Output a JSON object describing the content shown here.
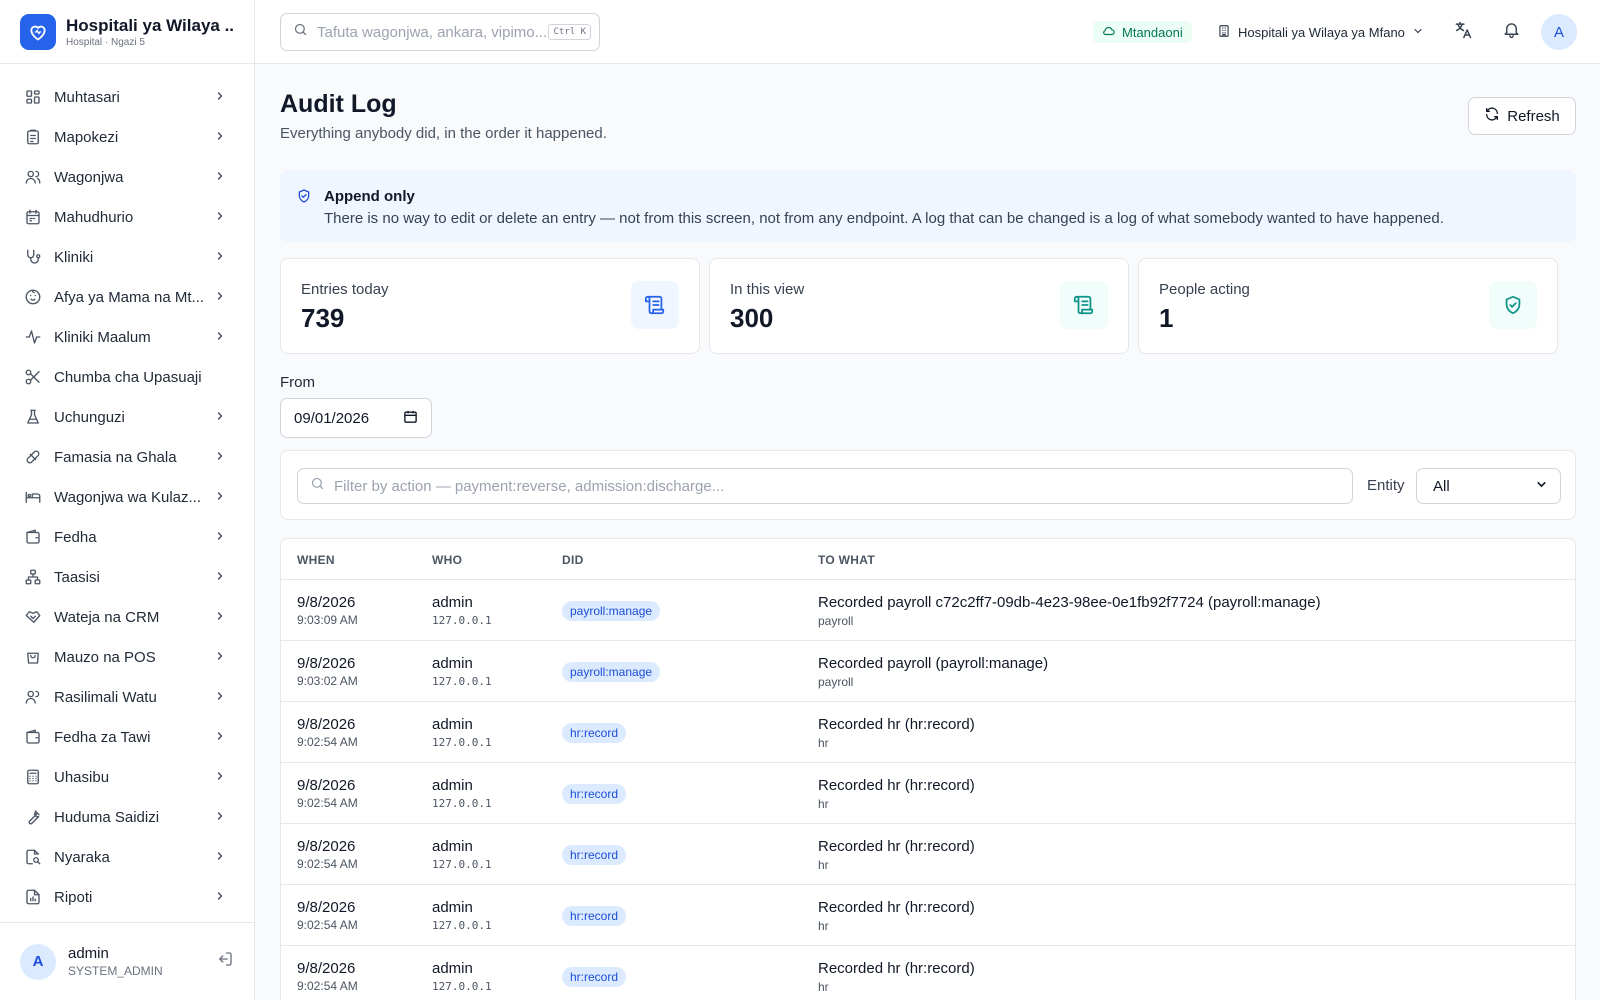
{
  "brand": {
    "name": "Hospitali ya Wilaya ...",
    "subtitle": "Hospital · Ngazi 5"
  },
  "sidebar": {
    "items": [
      {
        "label": "Muhtasari",
        "icon": "dashboard-icon",
        "chevron": true
      },
      {
        "label": "Mapokezi",
        "icon": "clipboard-icon",
        "chevron": true
      },
      {
        "label": "Wagonjwa",
        "icon": "users-icon",
        "chevron": true
      },
      {
        "label": "Mahudhurio",
        "icon": "calendar-icon",
        "chevron": true
      },
      {
        "label": "Kliniki",
        "icon": "stethoscope-icon",
        "chevron": true
      },
      {
        "label": "Afya ya Mama na Mt...",
        "icon": "baby-icon",
        "chevron": true
      },
      {
        "label": "Kliniki Maalum",
        "icon": "activity-icon",
        "chevron": true
      },
      {
        "label": "Chumba cha Upasuaji",
        "icon": "scissors-icon",
        "chevron": false
      },
      {
        "label": "Uchunguzi",
        "icon": "flask-icon",
        "chevron": true
      },
      {
        "label": "Famasia na Ghala",
        "icon": "pill-icon",
        "chevron": true
      },
      {
        "label": "Wagonjwa wa Kulaz...",
        "icon": "bed-icon",
        "chevron": true
      },
      {
        "label": "Fedha",
        "icon": "wallet-icon",
        "chevron": true
      },
      {
        "label": "Taasisi",
        "icon": "org-chart-icon",
        "chevron": true
      },
      {
        "label": "Wateja na CRM",
        "icon": "handshake-icon",
        "chevron": true
      },
      {
        "label": "Mauzo na POS",
        "icon": "shopping-bag-icon",
        "chevron": true
      },
      {
        "label": "Rasilimali Watu",
        "icon": "user-group-icon",
        "chevron": true
      },
      {
        "label": "Fedha za Tawi",
        "icon": "wallet-branch-icon",
        "chevron": true
      },
      {
        "label": "Uhasibu",
        "icon": "calculator-icon",
        "chevron": true
      },
      {
        "label": "Huduma Saidizi",
        "icon": "wrench-icon",
        "chevron": true
      },
      {
        "label": "Nyaraka",
        "icon": "file-search-icon",
        "chevron": true
      },
      {
        "label": "Ripoti",
        "icon": "report-icon",
        "chevron": true
      }
    ]
  },
  "user": {
    "initial": "A",
    "name": "admin",
    "role": "SYSTEM_ADMIN"
  },
  "topbar": {
    "search_placeholder": "Tafuta wagonjwa, ankara, vipimo...",
    "shortcut": "Ctrl K",
    "status": "Mtandaoni",
    "facility": "Hospitali ya Wilaya ya Mfano",
    "avatar_initial": "A"
  },
  "page": {
    "title": "Audit Log",
    "subtitle": "Everything anybody did, in the order it happened.",
    "refresh_label": "Refresh"
  },
  "notice": {
    "title": "Append only",
    "text": "There is no way to edit or delete an entry — not from this screen, not from any endpoint. A log that can be changed is a log of what somebody wanted to have happened."
  },
  "stats": [
    {
      "label": "Entries today",
      "value": "739",
      "icon": "scroll-icon",
      "color": "#2563eb",
      "bg": "#eff6ff"
    },
    {
      "label": "In this view",
      "value": "300",
      "icon": "scroll-icon",
      "color": "#0d9488",
      "bg": "#f0fdfa"
    },
    {
      "label": "People acting",
      "value": "1",
      "icon": "shield-check-icon",
      "color": "#0d9488",
      "bg": "#f0fdfa"
    }
  ],
  "filters": {
    "from_label": "From",
    "from_value": "09/01/2026",
    "action_placeholder": "Filter by action — payment:reverse, admission:discharge...",
    "entity_label": "Entity",
    "entity_value": "All"
  },
  "table": {
    "columns": [
      "WHEN",
      "WHO",
      "DID",
      "TO WHAT"
    ],
    "rows": [
      {
        "date": "9/8/2026",
        "time": "9:03:09 AM",
        "who": "admin",
        "ip": "127.0.0.1",
        "action": "payroll:manage",
        "what": "Recorded payroll c72c2ff7-09db-4e23-98ee-0e1fb92f7724 (payroll:manage)",
        "entity": "payroll"
      },
      {
        "date": "9/8/2026",
        "time": "9:03:02 AM",
        "who": "admin",
        "ip": "127.0.0.1",
        "action": "payroll:manage",
        "what": "Recorded payroll (payroll:manage)",
        "entity": "payroll"
      },
      {
        "date": "9/8/2026",
        "time": "9:02:54 AM",
        "who": "admin",
        "ip": "127.0.0.1",
        "action": "hr:record",
        "what": "Recorded hr (hr:record)",
        "entity": "hr"
      },
      {
        "date": "9/8/2026",
        "time": "9:02:54 AM",
        "who": "admin",
        "ip": "127.0.0.1",
        "action": "hr:record",
        "what": "Recorded hr (hr:record)",
        "entity": "hr"
      },
      {
        "date": "9/8/2026",
        "time": "9:02:54 AM",
        "who": "admin",
        "ip": "127.0.0.1",
        "action": "hr:record",
        "what": "Recorded hr (hr:record)",
        "entity": "hr"
      },
      {
        "date": "9/8/2026",
        "time": "9:02:54 AM",
        "who": "admin",
        "ip": "127.0.0.1",
        "action": "hr:record",
        "what": "Recorded hr (hr:record)",
        "entity": "hr"
      },
      {
        "date": "9/8/2026",
        "time": "9:02:54 AM",
        "who": "admin",
        "ip": "127.0.0.1",
        "action": "hr:record",
        "what": "Recorded hr (hr:record)",
        "entity": "hr"
      }
    ]
  },
  "colors": {
    "accent": "#2563eb",
    "online_bg": "#ecfdf5",
    "online_text": "#047857",
    "badge_bg": "#dbeafe",
    "badge_text": "#1d4ed8"
  }
}
